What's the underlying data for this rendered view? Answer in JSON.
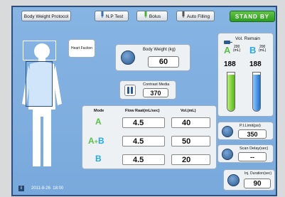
{
  "topbar": {
    "protocol_label": "Body Weight Protocol",
    "np_test_label": "N.P Test",
    "bolus_label": "Bolus",
    "auto_filling_label": "Auto Filling",
    "status_label": "STAND BY"
  },
  "heart_faction": {
    "label": "Heart Faction"
  },
  "body_weight": {
    "label": "Body Weight (kg)",
    "value": "60"
  },
  "contrast_media": {
    "label": "Contrast Media",
    "value": "370"
  },
  "mode_table": {
    "headers": {
      "mode": "Mode",
      "flow": "Flow Raat(mL/sec)",
      "vol": "Vol.(mL)"
    },
    "rows": [
      {
        "mode": "A",
        "flow": "4.5",
        "vol": "40"
      },
      {
        "mode_a": "A",
        "mode_plus": "+",
        "mode_b": "B",
        "flow": "4.5",
        "vol": "50"
      },
      {
        "mode": "B",
        "flow": "4.5",
        "vol": "20"
      }
    ]
  },
  "vol_remain": {
    "title": "Vol. Remain",
    "a_letter": "A",
    "a_num": "200",
    "a_unit": "(mL)",
    "b_letter": "B",
    "b_num": "200",
    "b_unit": "(mL)",
    "a_value": "188",
    "b_value": "188",
    "a_level": 0.94,
    "b_level": 0.94
  },
  "pi_limit": {
    "label": "P.I.Limit(psi)",
    "value": "350"
  },
  "scan_delay": {
    "label": "Scan Delay(sec)",
    "value": "--"
  },
  "inj_duration": {
    "label": "Inj. Duration(sec)",
    "value": "90"
  },
  "footer": {
    "datetime": "2011-8-26  18:00"
  },
  "colors": {
    "accent_green": "#2f9a22",
    "syringe_a": "#7ed321",
    "syringe_b": "#2f7fd8"
  }
}
